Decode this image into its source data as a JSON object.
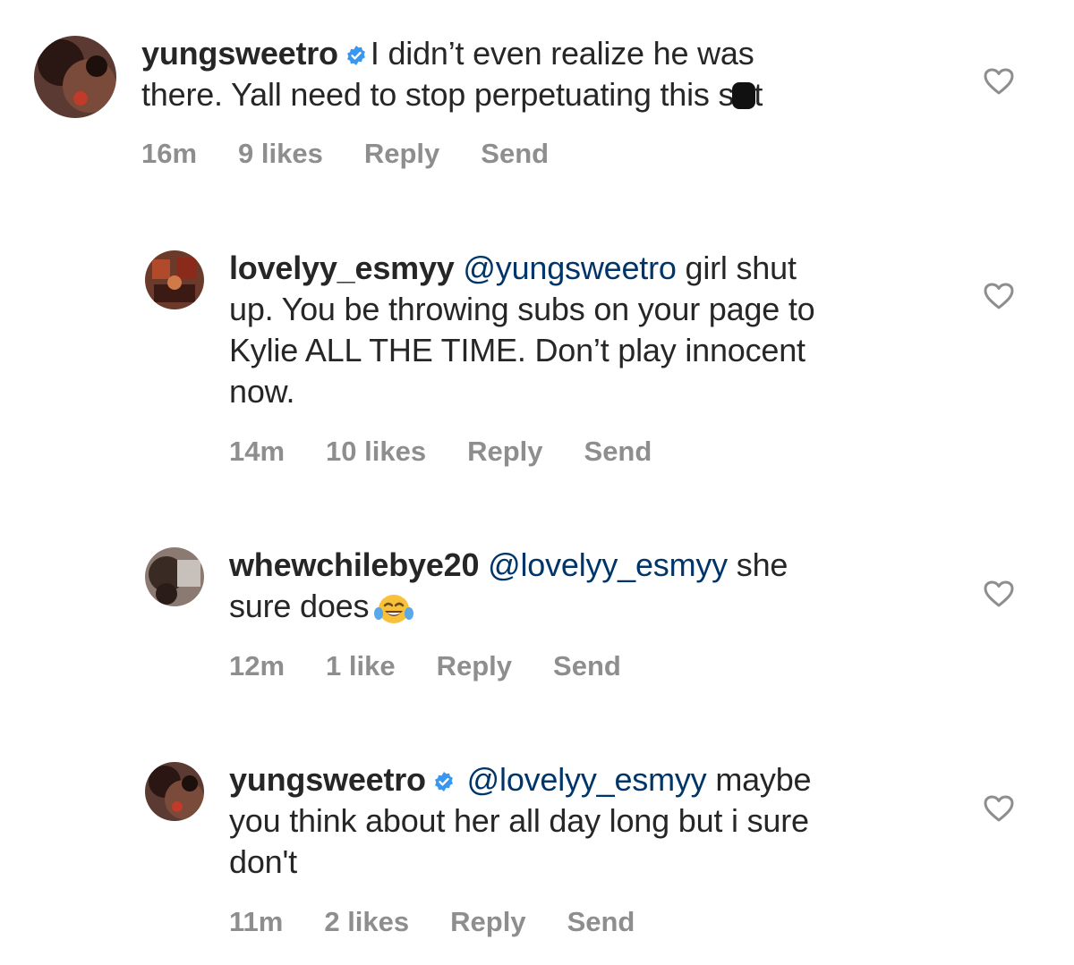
{
  "colors": {
    "text": "#262626",
    "meta": "#8e8e8e",
    "mention": "#003569",
    "verified": "#3897f0",
    "heart_outline": "#8e8e8e"
  },
  "comments": [
    {
      "username": "yungsweetro",
      "verified": true,
      "mention": "",
      "text_line1": "I didn’t even realize he was",
      "text_line2_pre": "there. Yall need to stop perpetuating this s",
      "text_line2_post": "t",
      "censored": true,
      "time": "16m",
      "likes": "9 likes",
      "reply_label": "Reply",
      "send_label": "Send",
      "like_icon": "heart-outline-icon"
    },
    {
      "username": "lovelyy_esmyy",
      "verified": false,
      "mention": "@yungsweetro",
      "text_line1": "girl shut",
      "text_line2": "up. You be throwing subs on your page to",
      "text_line3": "Kylie ALL THE TIME. Don’t play innocent",
      "text_line4": "now.",
      "time": "14m",
      "likes": "10 likes",
      "reply_label": "Reply",
      "send_label": "Send",
      "like_icon": "heart-outline-icon"
    },
    {
      "username": "whewchilebye20",
      "verified": false,
      "mention": "@lovelyy_esmyy",
      "text_line1": "she",
      "text_line2": "sure does",
      "emoji": "face-with-tears-of-joy",
      "time": "12m",
      "likes": "1 like",
      "reply_label": "Reply",
      "send_label": "Send",
      "like_icon": "heart-outline-icon"
    },
    {
      "username": "yungsweetro",
      "verified": true,
      "mention": "@lovelyy_esmyy",
      "text_line1": "maybe",
      "text_line2": "you think about her all day long but i sure",
      "text_line3": "don't",
      "time": "11m",
      "likes": "2 likes",
      "reply_label": "Reply",
      "send_label": "Send",
      "like_icon": "heart-outline-icon"
    }
  ]
}
